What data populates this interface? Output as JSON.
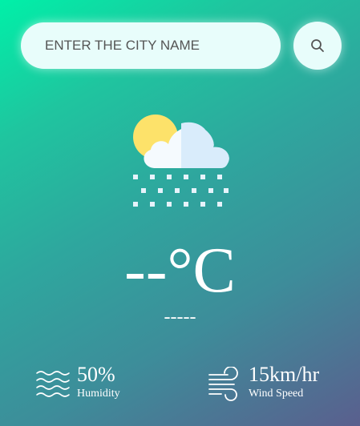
{
  "search": {
    "placeholder": "ENTER THE CITY NAME",
    "button_icon": "search-icon"
  },
  "weather": {
    "icon": "snow-cloud-sun-icon",
    "temperature": "--°C",
    "city": "-----"
  },
  "details": {
    "humidity": {
      "value": "50%",
      "label": "Humidity",
      "icon": "humidity-waves-icon"
    },
    "wind": {
      "value": "15km/hr",
      "label": "Wind Speed",
      "icon": "wind-icon"
    }
  },
  "colors": {
    "gradient_start": "#00f0a8",
    "gradient_end": "#5a5f8e",
    "input_bg": "#e8fdfb",
    "sun": "#fde26a",
    "cloud": "#e6f3fb"
  }
}
